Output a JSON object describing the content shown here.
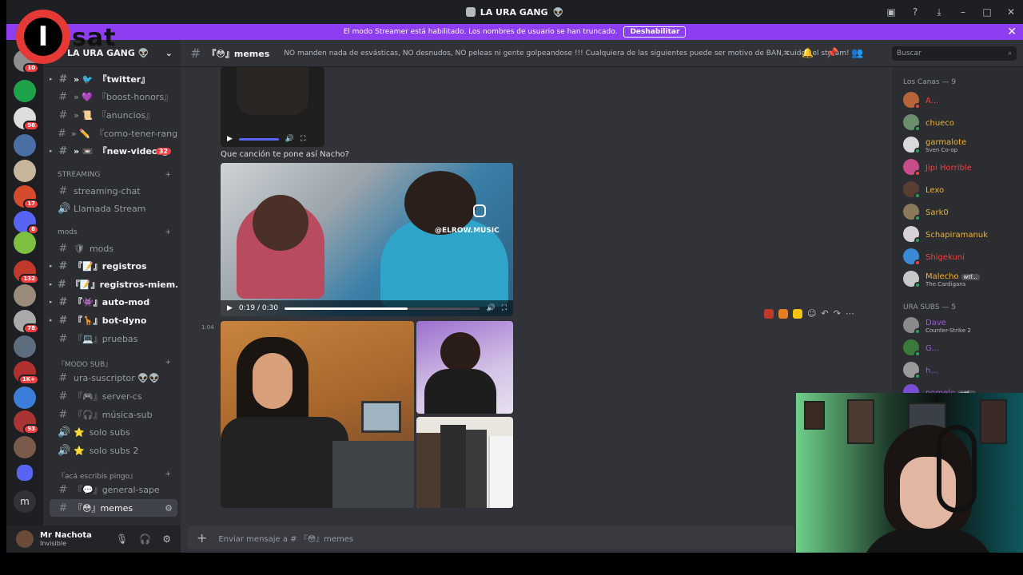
{
  "window": {
    "title": "LA URA GANG",
    "title_emoji": "👽"
  },
  "banner": {
    "text": "El modo Streamer está habilitado. Los nombres de usuario se han truncado.",
    "button": "Deshabilitar"
  },
  "logo": {
    "letter": "I",
    "text": "sat"
  },
  "rail": {
    "badges": [
      "10",
      "98",
      "17",
      "8",
      "132",
      "78",
      "1K+",
      "93"
    ]
  },
  "guild": {
    "name": "LA URA GANG",
    "emoji": "👽"
  },
  "channels": [
    {
      "label": "『twitter』",
      "prefix": "» 🐦"
    },
    {
      "label": "『boost-honors』",
      "prefix": "» 💜"
    },
    {
      "label": "『anuncios』",
      "prefix": "» 📜"
    },
    {
      "label": "『como-tener-rang...",
      "prefix": "» ✏️"
    },
    {
      "label": "『new-videos』",
      "prefix": "» 📼",
      "badge": "32"
    }
  ],
  "categories": {
    "streaming": "STREAMING",
    "mods": "mods",
    "modo_sub": "『MODO SUB』",
    "aca": "『acá escribís pingo』"
  },
  "streaming_channels": [
    {
      "label": "streaming-chat"
    },
    {
      "label": "Llamada Stream"
    }
  ],
  "mods_channels": [
    {
      "label": "mods",
      "prefix": "🛡"
    },
    {
      "label": "『📝』registros"
    },
    {
      "label": "『📝』registros-miem..."
    },
    {
      "label": "『👾』auto-mod"
    },
    {
      "label": "『🦒』bot-dyno"
    },
    {
      "label": "『💻』pruebas"
    }
  ],
  "sub_channels": [
    {
      "label": "ura-suscriptor 👽👽"
    },
    {
      "label": "『🎮』server-cs"
    },
    {
      "label": "『🎧』música-sub"
    },
    {
      "label": "solo subs",
      "prefix": "⭐"
    },
    {
      "label": "solo subs 2",
      "prefix": "⭐"
    }
  ],
  "aca_channels": [
    {
      "label": "『💬』general-sape"
    },
    {
      "label": "『😳』memes"
    }
  ],
  "user": {
    "name": "Mr Nachota",
    "status": "Invisible"
  },
  "header": {
    "channel": "『😳』memes",
    "topic": "NO manden nada de esvásticas, NO desnudos, NO peleas ni gente golpeandose !!! Cualquiera de las siguientes puede ser motivo de BAN, cuiden el stream!",
    "search_placeholder": "Buscar"
  },
  "chat": {
    "message_text": "Que canción te pone así Nacho?",
    "video_time": "0:19 / 0:30",
    "video_progress": 0.63,
    "video_watermark": "@ELROW.MUSIC",
    "timestamp": "1:04"
  },
  "composer": {
    "placeholder": "Enviar mensaje a # 『😳』memes"
  },
  "members": {
    "group1": "Los Canas — 9",
    "group2": "URA SUBS — 5",
    "list1": [
      {
        "name": "A...",
        "color": "#f23f42"
      },
      {
        "name": "chueco",
        "color": "#f0b232"
      },
      {
        "name": "garmalote",
        "color": "#f0b232",
        "sub": "Sven Co-op"
      },
      {
        "name": "Jipi Horrible",
        "color": "#f23f42"
      },
      {
        "name": "Lexo",
        "color": "#f0b232"
      },
      {
        "name": "Sark0",
        "color": "#f0b232"
      },
      {
        "name": "Schapiramanuk",
        "color": "#f0b232"
      },
      {
        "name": "Shigekuni",
        "color": "#f23f42"
      },
      {
        "name": "Malecho",
        "color": "#f0b232",
        "tag": "wtf...",
        "sub": "The Cardigans"
      }
    ],
    "list2": [
      {
        "name": "Dave",
        "color": "#9b59d6",
        "sub": "Counter-Strike 2"
      },
      {
        "name": "G...",
        "color": "#9b59d6"
      },
      {
        "name": "h...",
        "color": "#9b59d6"
      },
      {
        "name": "pomelo",
        "color": "#9b59d6",
        "tag": "wtf..."
      }
    ]
  }
}
